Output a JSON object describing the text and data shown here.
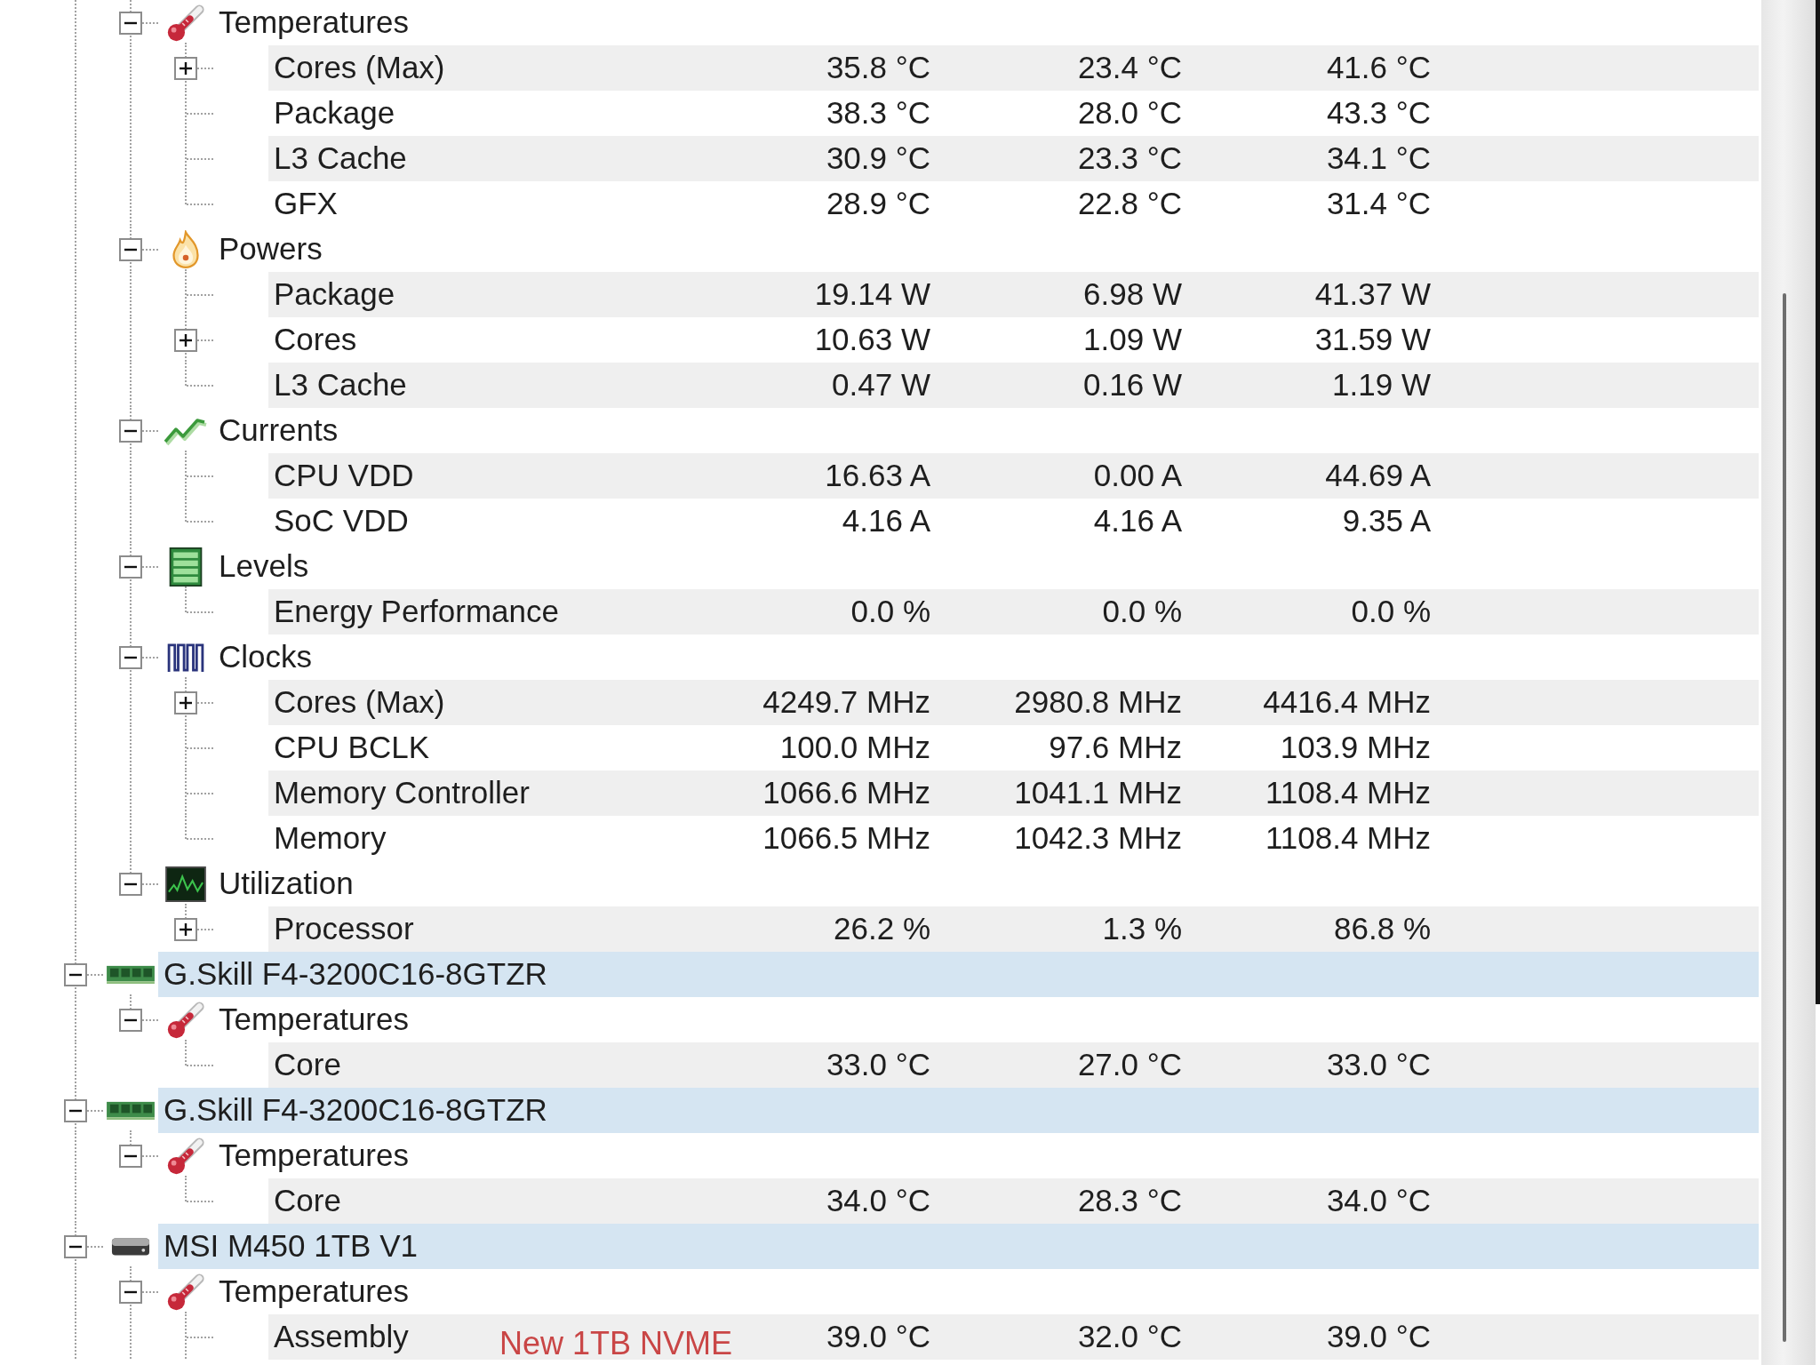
{
  "tree": {
    "continues_below": true,
    "nodes": [
      {
        "children": [
          {
            "label": "Temperatures",
            "kind": "temperature",
            "expanded": true,
            "children": [
              {
                "label": "Cores (Max)",
                "values": [
                  "35.8 °C",
                  "23.4 °C",
                  "41.6 °C"
                ],
                "expanded": false
              },
              {
                "label": "Package",
                "values": [
                  "38.3 °C",
                  "28.0 °C",
                  "43.3 °C"
                ]
              },
              {
                "label": "L3 Cache",
                "values": [
                  "30.9 °C",
                  "23.3 °C",
                  "34.1 °C"
                ]
              },
              {
                "label": "GFX",
                "values": [
                  "28.9 °C",
                  "22.8 °C",
                  "31.4 °C"
                ]
              }
            ]
          },
          {
            "label": "Powers",
            "kind": "power",
            "expanded": true,
            "children": [
              {
                "label": "Package",
                "values": [
                  "19.14 W",
                  "6.98 W",
                  "41.37 W"
                ]
              },
              {
                "label": "Cores",
                "values": [
                  "10.63 W",
                  "1.09 W",
                  "31.59 W"
                ],
                "expanded": false
              },
              {
                "label": "L3 Cache",
                "values": [
                  "0.47 W",
                  "0.16 W",
                  "1.19 W"
                ]
              }
            ]
          },
          {
            "label": "Currents",
            "kind": "current",
            "expanded": true,
            "children": [
              {
                "label": "CPU VDD",
                "values": [
                  "16.63 A",
                  "0.00 A",
                  "44.69 A"
                ]
              },
              {
                "label": "SoC VDD",
                "values": [
                  "4.16 A",
                  "4.16 A",
                  "9.35 A"
                ]
              }
            ]
          },
          {
            "label": "Levels",
            "kind": "level",
            "expanded": true,
            "children": [
              {
                "label": "Energy Performance",
                "values": [
                  "0.0 %",
                  "0.0 %",
                  "0.0 %"
                ]
              }
            ]
          },
          {
            "label": "Clocks",
            "kind": "clock",
            "expanded": true,
            "children": [
              {
                "label": "Cores (Max)",
                "values": [
                  "4249.7 MHz",
                  "2980.8 MHz",
                  "4416.4 MHz"
                ],
                "expanded": false
              },
              {
                "label": "CPU BCLK",
                "values": [
                  "100.0 MHz",
                  "97.6 MHz",
                  "103.9 MHz"
                ]
              },
              {
                "label": "Memory Controller",
                "values": [
                  "1066.6 MHz",
                  "1041.1 MHz",
                  "1108.4 MHz"
                ]
              },
              {
                "label": "Memory",
                "values": [
                  "1066.5 MHz",
                  "1042.3 MHz",
                  "1108.4 MHz"
                ]
              }
            ]
          },
          {
            "label": "Utilization",
            "kind": "utilization",
            "expanded": true,
            "children": [
              {
                "label": "Processor",
                "values": [
                  "26.2 %",
                  "1.3 %",
                  "86.8 %"
                ],
                "expanded": false
              }
            ]
          }
        ]
      },
      {
        "label": "G.Skill F4-3200C16-8GTZR",
        "kind": "memory",
        "expanded": true,
        "children": [
          {
            "label": "Temperatures",
            "kind": "temperature",
            "expanded": true,
            "children": [
              {
                "label": "Core",
                "values": [
                  "33.0 °C",
                  "27.0 °C",
                  "33.0 °C"
                ]
              }
            ]
          }
        ]
      },
      {
        "label": "G.Skill F4-3200C16-8GTZR",
        "kind": "memory",
        "expanded": true,
        "children": [
          {
            "label": "Temperatures",
            "kind": "temperature",
            "expanded": true,
            "children": [
              {
                "label": "Core",
                "values": [
                  "34.0 °C",
                  "28.3 °C",
                  "34.0 °C"
                ]
              }
            ]
          }
        ]
      },
      {
        "label": "MSI M450 1TB V1",
        "kind": "drive",
        "expanded": true,
        "children": [
          {
            "label": "Temperatures",
            "kind": "temperature",
            "expanded": true,
            "children": [
              {
                "label": "Assembly",
                "values": [
                  "39.0 °C",
                  "32.0 °C",
                  "39.0 °C"
                ]
              }
            ]
          }
        ]
      }
    ]
  },
  "annotation": "New 1TB NVME"
}
